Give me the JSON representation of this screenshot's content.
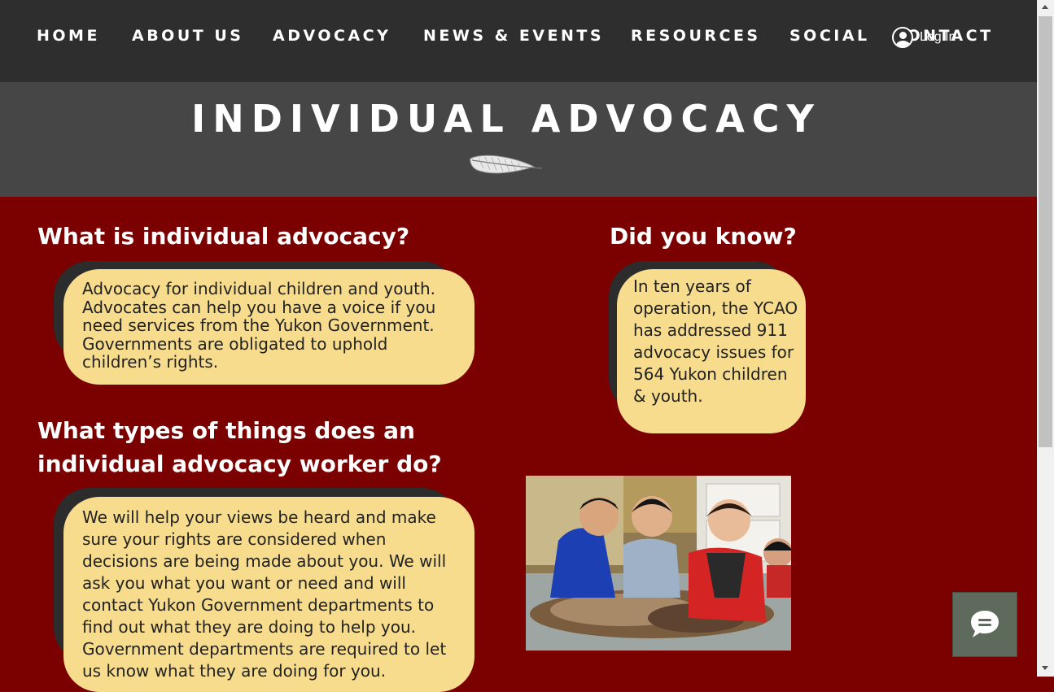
{
  "nav": {
    "items": [
      "HOME",
      "ABOUT US",
      "ADVOCACY",
      "NEWS & EVENTS",
      "RESOURCES",
      "SOCIAL",
      "CONTACT"
    ],
    "login_label": "Log In",
    "background": "#2e2e2e"
  },
  "hero": {
    "title": "INDIVIDUAL ADVOCACY",
    "icon": "feather-icon",
    "background": "#464646"
  },
  "sections": {
    "what_is": {
      "heading": "What is individual advocacy?",
      "body": "Advocacy for individual children and youth. Advocates can help you have a voice if you need services from the Yukon Government. Governments are obligated to uphold children’s rights."
    },
    "what_types": {
      "heading_line1": "What types of things does an",
      "heading_line2": "individual advocacy worker do?",
      "body": "We will help your views be heard and make sure your rights are considered when decisions are being made about you. We will ask you what you want or need and will contact Yukon Government departments to find out what they are doing to help you. Government departments are required to let us know what they are doing for you."
    },
    "did_you_know": {
      "heading": "Did you know?",
      "body": "In ten years of operation, the YCAO has addressed 911 advocacy issues for 564 Yukon children & youth."
    }
  },
  "photo": {
    "icon": "children-photo"
  },
  "chat": {
    "icon": "chat-icon"
  },
  "colors": {
    "page_background": "#7b0000",
    "bubble": "#f6dc8c",
    "bubble_shadow": "#2c2c2c",
    "chat_button": "#5e6b5c"
  }
}
